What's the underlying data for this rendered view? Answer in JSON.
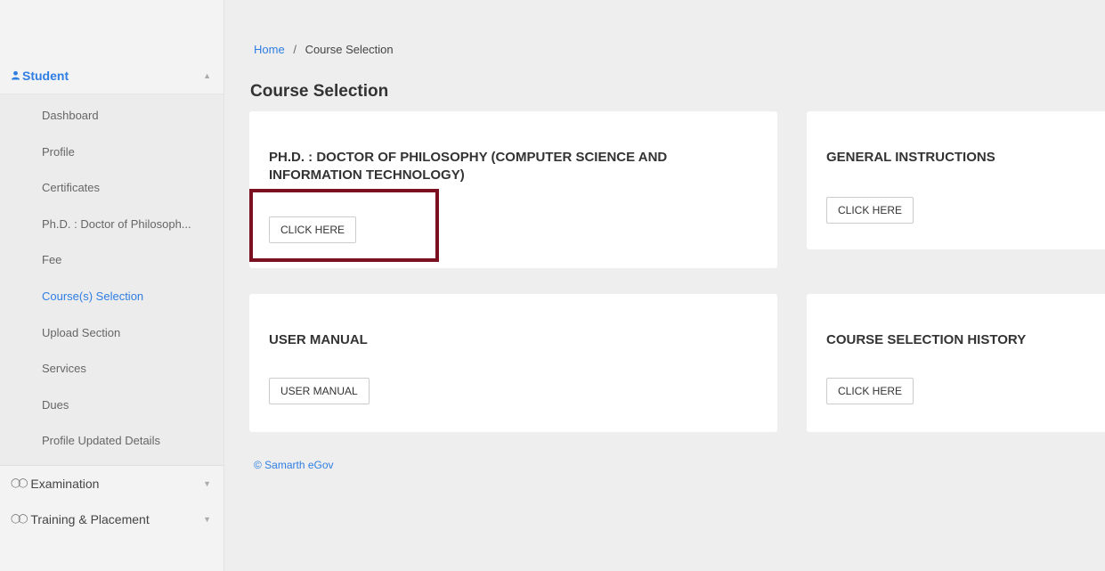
{
  "sidebar": {
    "student_label": "Student",
    "items": [
      {
        "label": "Dashboard",
        "active": false
      },
      {
        "label": "Profile",
        "active": false
      },
      {
        "label": "Certificates",
        "active": false
      },
      {
        "label": "Ph.D. : Doctor of Philosoph...",
        "active": false
      },
      {
        "label": "Fee",
        "active": false
      },
      {
        "label": "Course(s) Selection",
        "active": true
      },
      {
        "label": "Upload Section",
        "active": false
      },
      {
        "label": "Services",
        "active": false
      },
      {
        "label": "Dues",
        "active": false
      },
      {
        "label": "Profile Updated Details",
        "active": false
      }
    ],
    "examination_label": "Examination",
    "training_label": "Training & Placement"
  },
  "breadcrumb": {
    "home": "Home",
    "separator": "/",
    "current": "Course Selection"
  },
  "page_title": "Course Selection",
  "cards": {
    "phd": {
      "title": "PH.D. : DOCTOR OF PHILOSOPHY (COMPUTER SCIENCE AND INFORMATION TECHNOLOGY)",
      "button": "CLICK HERE"
    },
    "instructions": {
      "title": "GENERAL INSTRUCTIONS",
      "button": "CLICK HERE"
    },
    "manual": {
      "title": "USER MANUAL",
      "button": "USER MANUAL"
    },
    "history": {
      "title": "COURSE SELECTION HISTORY",
      "button": "CLICK HERE"
    }
  },
  "footer": "© Samarth eGov",
  "colors": {
    "accent": "#2f7ee3",
    "highlight": "#7a1020",
    "background": "#eeeeee"
  }
}
